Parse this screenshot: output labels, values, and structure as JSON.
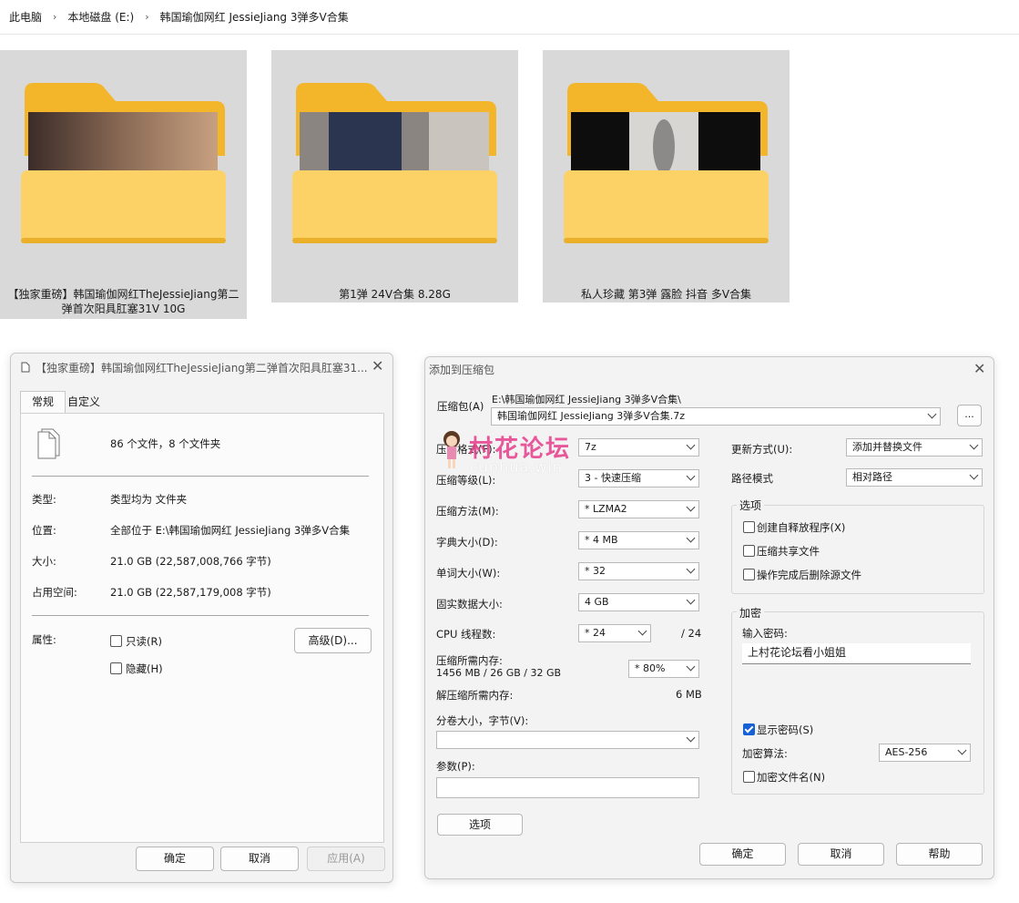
{
  "breadcrumb": {
    "items": [
      "此电脑",
      "本地磁盘 (E:)",
      "韩国瑜伽网红 JessieJiang 3弹多V合集"
    ],
    "separator": "›"
  },
  "folders": [
    {
      "line1": "【独家重磅】韩国瑜伽网红TheJessieJiang第二",
      "line2": "弹首次阳具肛塞31V 10G"
    },
    {
      "line1": "第1弹 24V合集 8.28G",
      "line2": ""
    },
    {
      "line1": "私人珍藏 第3弹 露脸 抖音 多V合集",
      "line2": ""
    }
  ],
  "props": {
    "title": "【独家重磅】韩国瑜伽网红TheJessieJiang第二弹首次阳具肛塞31...",
    "tabs": [
      "常规",
      "自定义"
    ],
    "summary": "86 个文件，8 个文件夹",
    "rows": [
      {
        "label": "类型:",
        "value": "类型均为 文件夹"
      },
      {
        "label": "位置:",
        "value": "全部位于 E:\\韩国瑜伽网红 JessieJiang 3弹多V合集"
      },
      {
        "label": "大小:",
        "value": "21.0 GB (22,587,008,766 字节)"
      },
      {
        "label": "占用空间:",
        "value": "21.0 GB (22,587,179,008 字节)"
      }
    ],
    "attr_label": "属性:",
    "readonly": "只读(R)",
    "hidden": "隐藏(H)",
    "advanced": "高级(D)...",
    "ok": "确定",
    "cancel": "取消",
    "apply": "应用(A)"
  },
  "archive": {
    "title": "添加到压缩包",
    "archive_label": "压缩包(A)",
    "path": "E:\\韩国瑜伽网红 JessieJiang 3弹多V合集\\",
    "filename": "韩国瑜伽网红 JessieJiang 3弹多V合集.7z",
    "browse": "...",
    "fields": [
      {
        "label": "压缩格式(F):",
        "value": "7z"
      },
      {
        "label": "压缩等级(L):",
        "value": "3 - 快速压缩"
      },
      {
        "label": "压缩方法(M):",
        "value": "*  LZMA2"
      },
      {
        "label": "字典大小(D):",
        "value": "*  4 MB"
      },
      {
        "label": "单词大小(W):",
        "value": "*  32"
      },
      {
        "label": "固实数据大小:",
        "value": "4 GB"
      }
    ],
    "cpu_label": "CPU 线程数:",
    "cpu_value": "*  24",
    "cpu_max": "/ 24",
    "mem_label": "压缩所需内存:",
    "mem_value": "1456 MB / 26 GB / 32 GB",
    "mem_pct": "* 80%",
    "decomp_label": "解压缩所需内存:",
    "decomp_value": "6 MB",
    "split_label": "分卷大小，字节(V):",
    "split_value": "",
    "params_label": "参数(P):",
    "params_value": "",
    "options_btn": "选项",
    "update_label": "更新方式(U):",
    "update_value": "添加并替换文件",
    "pathmode_label": "路径模式",
    "pathmode_value": "相对路径",
    "options_group": "选项",
    "opt1": "创建自释放程序(X)",
    "opt2": "压缩共享文件",
    "opt3": "操作完成后删除源文件",
    "enc_group": "加密",
    "pwd_label": "输入密码:",
    "pwd_value": "上村花论坛看小姐姐",
    "show_pwd": "显示密码(S)",
    "enc_method_label": "加密算法:",
    "enc_method_value": "AES-256",
    "enc_names": "加密文件名(N)",
    "ok": "确定",
    "cancel": "取消",
    "help": "帮助"
  },
  "watermark": {
    "text": "村花论坛",
    "sub": "cunhua.win"
  }
}
